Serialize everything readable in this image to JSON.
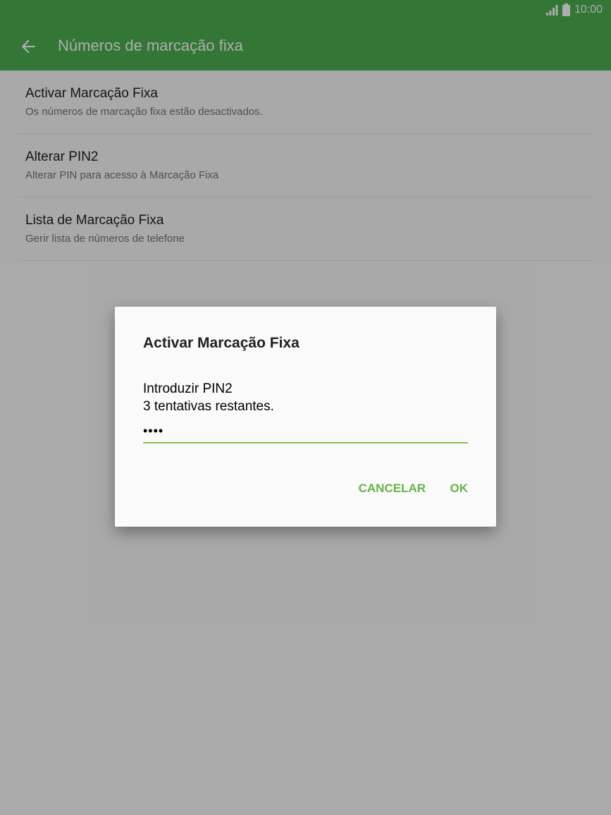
{
  "status_bar": {
    "time": "10:00",
    "signal_icon": "signal-icon",
    "battery_icon": "battery-icon"
  },
  "app_bar": {
    "title": "Números de marcação fixa",
    "back_icon": "arrow-back-icon",
    "color": "#4caf50"
  },
  "list": {
    "items": [
      {
        "title": "Activar Marcação Fixa",
        "subtitle": "Os números de marcação fixa estão desactivados."
      },
      {
        "title": "Alterar PIN2",
        "subtitle": "Alterar PIN para acesso à Marcação Fixa"
      },
      {
        "title": "Lista de Marcação Fixa",
        "subtitle": "Gerir lista de números de telefone"
      }
    ]
  },
  "dialog": {
    "title": "Activar Marcação Fixa",
    "prompt": "Introduzir PIN2",
    "attempts": "3 tentativas restantes.",
    "pin_value": "••••",
    "cancel_label": "CANCELAR",
    "ok_label": "OK",
    "accent_color": "#66b24a"
  }
}
